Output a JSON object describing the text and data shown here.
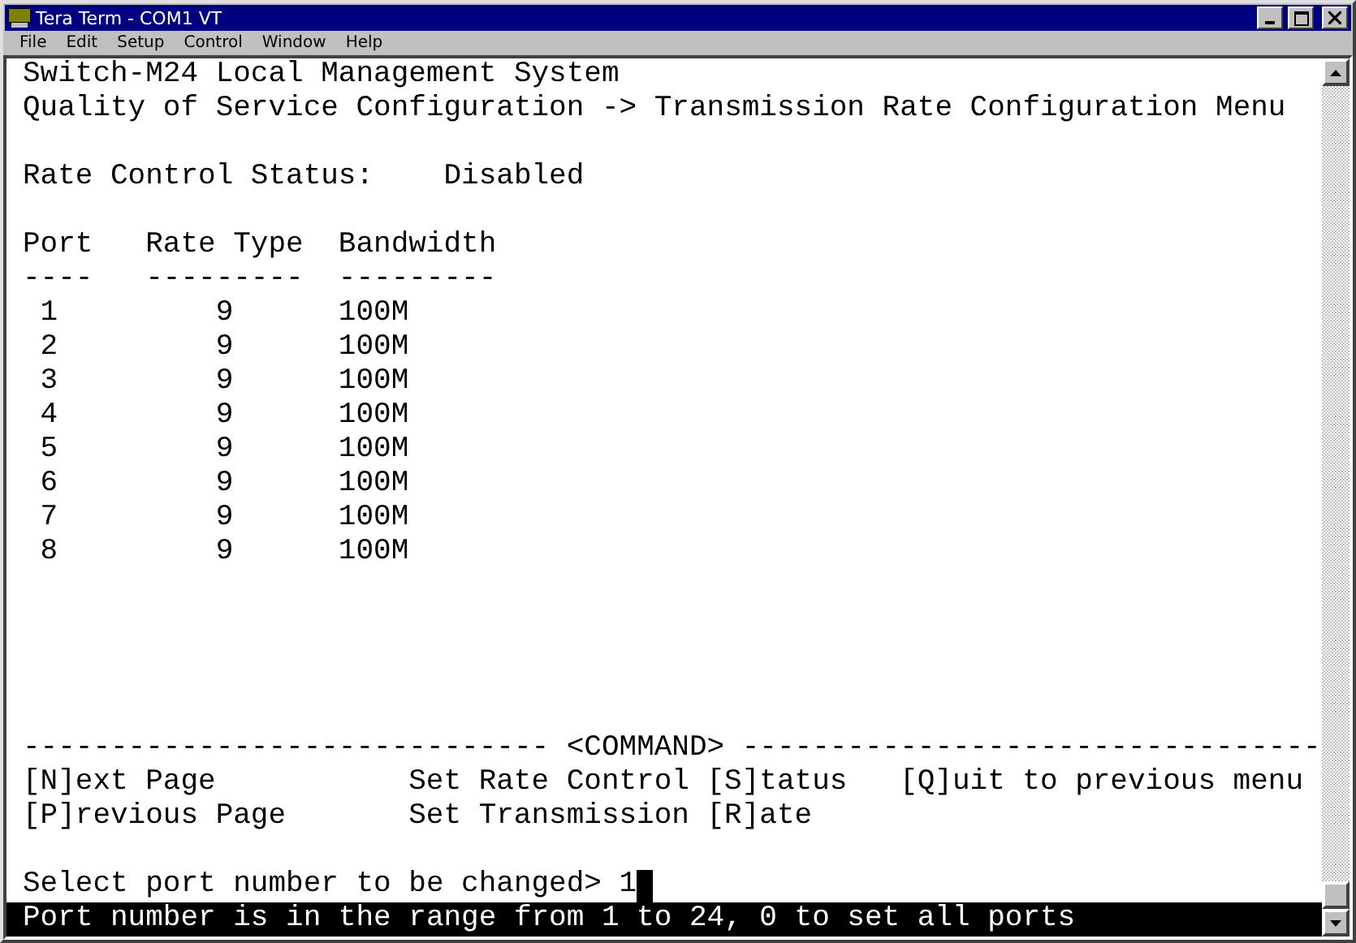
{
  "window": {
    "title": "Tera Term - COM1 VT"
  },
  "menu": [
    "File",
    "Edit",
    "Setup",
    "Control",
    "Window",
    "Help"
  ],
  "terminal": {
    "header_lines": [
      "Switch-M24 Local Management System",
      "Quality of Service Configuration -> Transmission Rate Configuration Menu"
    ],
    "status": {
      "label": "Rate Control Status:",
      "value": "Disabled"
    },
    "table": {
      "columns": [
        {
          "heading": "Port",
          "rule": "----"
        },
        {
          "heading": "Rate Type",
          "rule": "---------"
        },
        {
          "heading": "Bandwidth",
          "rule": "---------"
        }
      ],
      "rows": [
        [
          "1",
          "9",
          "100M"
        ],
        [
          "2",
          "9",
          "100M"
        ],
        [
          "3",
          "9",
          "100M"
        ],
        [
          "4",
          "9",
          "100M"
        ],
        [
          "5",
          "9",
          "100M"
        ],
        [
          "6",
          "9",
          "100M"
        ],
        [
          "7",
          "9",
          "100M"
        ],
        [
          "8",
          "9",
          "100M"
        ]
      ]
    },
    "command_rule": {
      "left": "------------------------------",
      "label": "<COMMAND>",
      "right": "---------------------------------"
    },
    "commands": [
      [
        "[N]ext Page",
        "Set Rate Control [S]tatus",
        "[Q]uit to previous menu"
      ],
      [
        "[P]revious Page",
        "Set Transmission [R]ate"
      ]
    ],
    "prompt": {
      "label": "Select port number to be changed>",
      "value": "1"
    },
    "status_line": "Port number is in the range from 1 to 24, 0 to set all ports"
  }
}
